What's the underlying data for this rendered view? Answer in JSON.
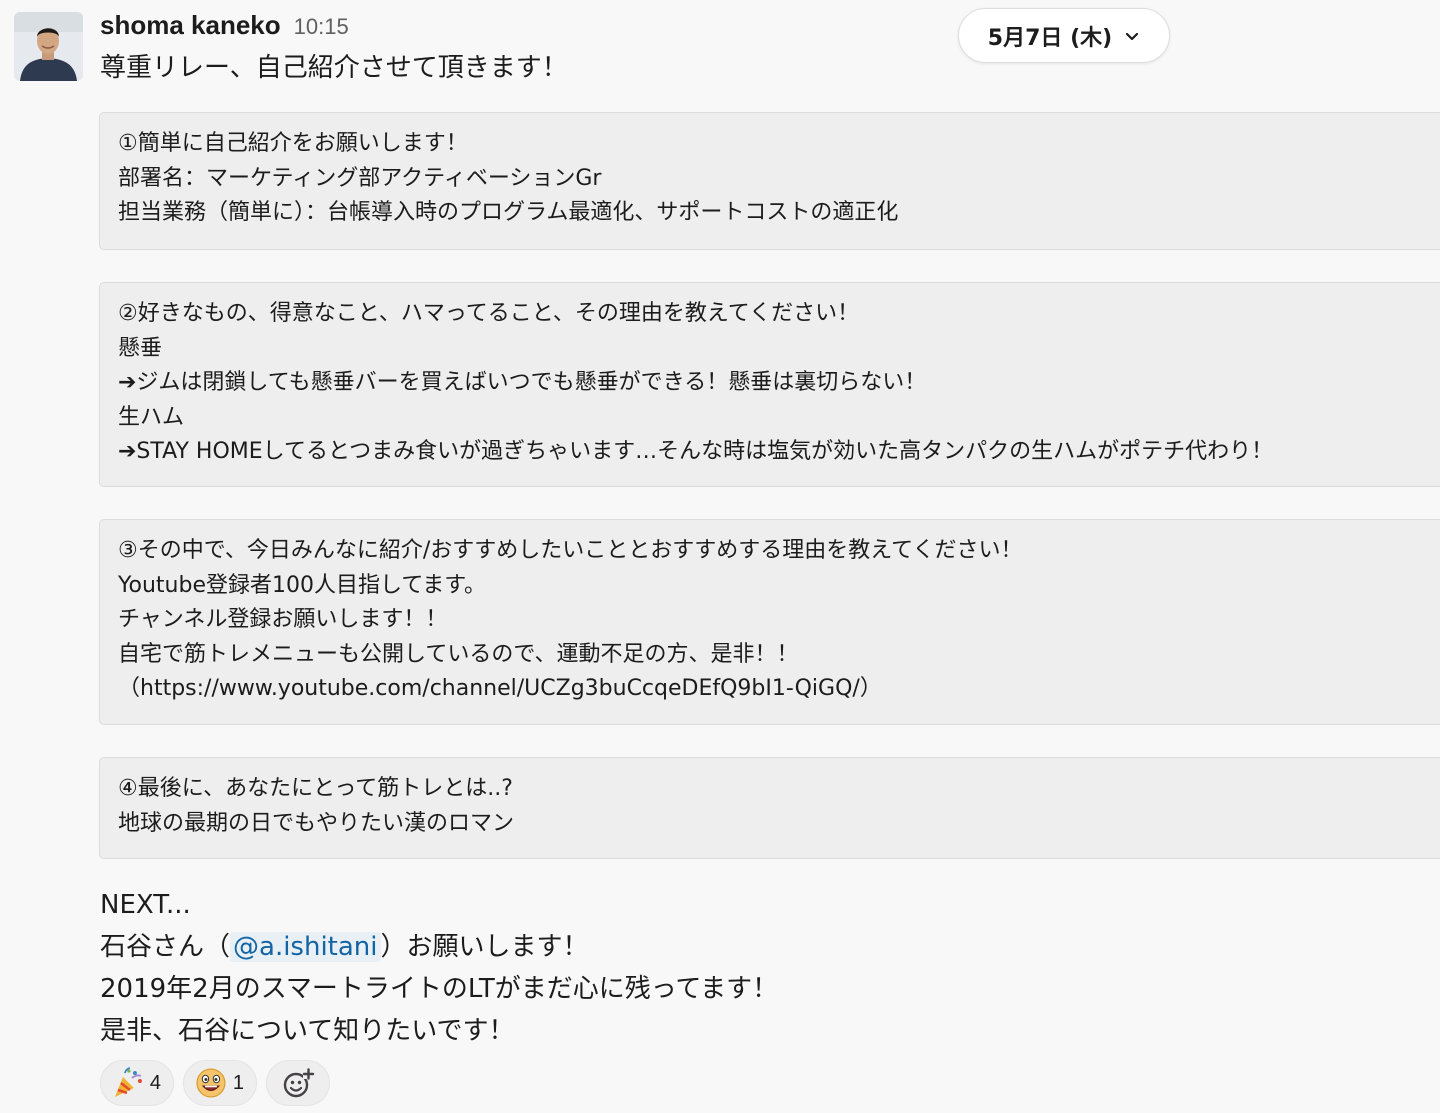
{
  "message": {
    "author": "shoma kaneko",
    "time": "10:15",
    "intro": "尊重リレー、自己紹介させて頂きます！"
  },
  "date_divider": {
    "label": "5月7日 (木)"
  },
  "blocks": [
    {
      "lines": [
        "①簡単に自己紹介をお願いします！",
        "部署名：マーケティング部アクティベーションGr",
        "担当業務（簡単に）：台帳導入時のプログラム最適化、サポートコストの適正化"
      ]
    },
    {
      "lines": [
        "②好きなもの、得意なこと、ハマってること、その理由を教えてください！",
        "懸垂",
        "➔ジムは閉鎖しても懸垂バーを買えばいつでも懸垂ができる！懸垂は裏切らない！",
        "生ハム",
        "➔STAY HOMEしてるとつまみ食いが過ぎちゃいます…そんな時は塩気が効いた高タンパクの生ハムがポテチ代わり！"
      ]
    },
    {
      "lines": [
        "③その中で、今日みんなに紹介/おすすめしたいこととおすすめする理由を教えてください！",
        "Youtube登録者100人目指してます。",
        "チャンネル登録お願いします！！",
        "自宅で筋トレメニューも公開しているので、運動不足の方、是非！！",
        "（https://www.youtube.com/channel/UCZg3buCcqeDEfQ9bI1-QiGQ/）"
      ]
    },
    {
      "lines": [
        "④最後に、あなたにとって筋トレとは..?",
        "地球の最期の日でもやりたい漢のロマン"
      ]
    }
  ],
  "footer": {
    "line1": "NEXT...",
    "line2_pre": " 石谷さん（",
    "mention": "@a.ishitani",
    "line2_post": "）お願いします！",
    "line3": "2019年2月のスマートライトのLTがまだ心に残ってます！",
    "line4": "是非、石谷について知りたいです！"
  },
  "reactions": [
    {
      "icon": "party-popper-icon",
      "count": "4"
    },
    {
      "icon": "grinning-face-icon",
      "count": "1"
    },
    {
      "icon": "add-reaction-icon",
      "count": ""
    }
  ],
  "colors": {
    "background": "#f8f8f8",
    "block_background": "#eeeeee",
    "mention_text": "#1264a3",
    "text": "#1d1c1d",
    "muted": "#616061"
  }
}
